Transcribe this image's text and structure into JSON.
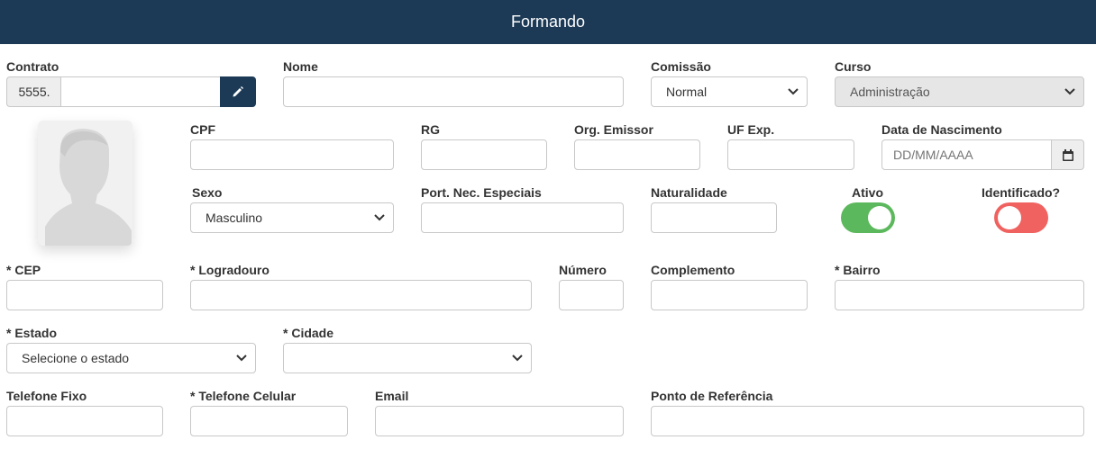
{
  "header": {
    "title": "Formando"
  },
  "contrato": {
    "label": "Contrato",
    "prefix": "5555.",
    "value": ""
  },
  "nome": {
    "label": "Nome",
    "value": ""
  },
  "comissao": {
    "label": "Comissão",
    "selected": "Normal"
  },
  "curso": {
    "label": "Curso",
    "selected": "Administração"
  },
  "cpf": {
    "label": "CPF"
  },
  "rg": {
    "label": "RG"
  },
  "org_emissor": {
    "label": "Org. Emissor"
  },
  "uf_exp": {
    "label": "UF Exp."
  },
  "data_nascimento": {
    "label": "Data de Nascimento",
    "placeholder": "DD/MM/AAAA"
  },
  "sexo": {
    "label": "Sexo",
    "selected": "Masculino"
  },
  "port_nec": {
    "label": "Port. Nec. Especiais"
  },
  "naturalidade": {
    "label": "Naturalidade"
  },
  "ativo": {
    "label": "Ativo",
    "on": true,
    "color": "#5cb85c"
  },
  "identificado": {
    "label": "Identificado?",
    "on": false,
    "color": "#f0625f"
  },
  "cep": {
    "label": "* CEP"
  },
  "logradouro": {
    "label": "* Logradouro"
  },
  "numero": {
    "label": "Número"
  },
  "complemento": {
    "label": "Complemento"
  },
  "bairro": {
    "label": "* Bairro"
  },
  "estado": {
    "label": "* Estado",
    "selected": "Selecione o estado"
  },
  "cidade": {
    "label": "* Cidade",
    "selected": ""
  },
  "telefone_fixo": {
    "label": "Telefone Fixo"
  },
  "telefone_celular": {
    "label": "* Telefone Celular"
  },
  "email": {
    "label": "Email"
  },
  "ponto_referencia": {
    "label": "Ponto de Referência"
  },
  "colors": {
    "header_bg": "#1c3a56",
    "button_bg": "#1c3a56"
  }
}
